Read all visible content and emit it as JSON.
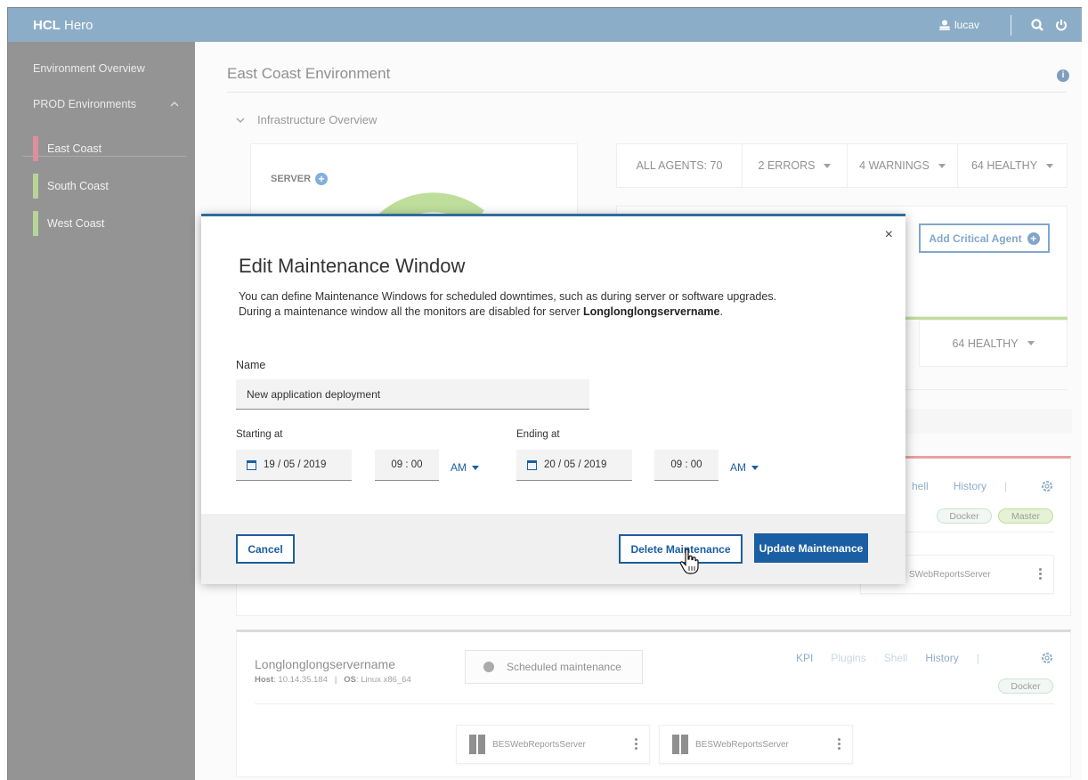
{
  "app": {
    "brand_bold": "HCL",
    "brand_rest": "Hero",
    "user": "lucav"
  },
  "sidebar": {
    "overview": "Environment Overview",
    "group": "PROD Environments",
    "items": [
      {
        "label": "East Coast",
        "color": "#c0334d"
      },
      {
        "label": "South Coast",
        "color": "#7cb342"
      },
      {
        "label": "West Coast",
        "color": "#7cb342"
      }
    ]
  },
  "main": {
    "title": "East Coast Environment",
    "section": "Infrastructure Overview",
    "server_label": "SERVER",
    "agents": {
      "all": "ALL AGENTS: 70",
      "errors": "2 ERRORS",
      "warnings": "4 WARNINGS",
      "healthy": "64 HEALTHY"
    },
    "add_critical": "Add Critical Agent",
    "healthy2": "64 HEALTHY",
    "server1": {
      "links": [
        "hell",
        "History",
        "|"
      ],
      "tags": [
        "Docker",
        "Master"
      ],
      "agent": "SWebReportsServer"
    },
    "server2": {
      "name": "Longlonglongservername",
      "host_label": "Host",
      "host": "10.14.35.184",
      "sep": "|",
      "os_label": "OS",
      "os": "Linux x86_64",
      "scheduled": "Scheduled maintenance",
      "links": [
        "KPI",
        "Plugins",
        "Shell",
        "History",
        "|"
      ],
      "tag": "Docker",
      "agents": [
        "BESWebReportsServer",
        "BESWebReportsServer"
      ]
    }
  },
  "modal": {
    "close": "×",
    "title": "Edit Maintenance Window",
    "desc_line1": "You can define Maintenance Windows for scheduled downtimes, such as during server or software upgrades.",
    "desc_line2_prefix": "During a maintenance window all the monitors are disabled for server ",
    "desc_server": "Longlonglongservername",
    "desc_suffix": ".",
    "name_label": "Name",
    "name_value": "New application deployment",
    "start_label": "Starting at",
    "start_date": "19 / 05 / 2019",
    "start_time": "09 : 00",
    "start_ampm": "AM",
    "end_label": "Ending at",
    "end_date": "20 / 05 / 2019",
    "end_time": "09 : 00",
    "end_ampm": "AM",
    "cancel": "Cancel",
    "delete": "Delete Maintenance",
    "update": "Update Maintenance"
  }
}
